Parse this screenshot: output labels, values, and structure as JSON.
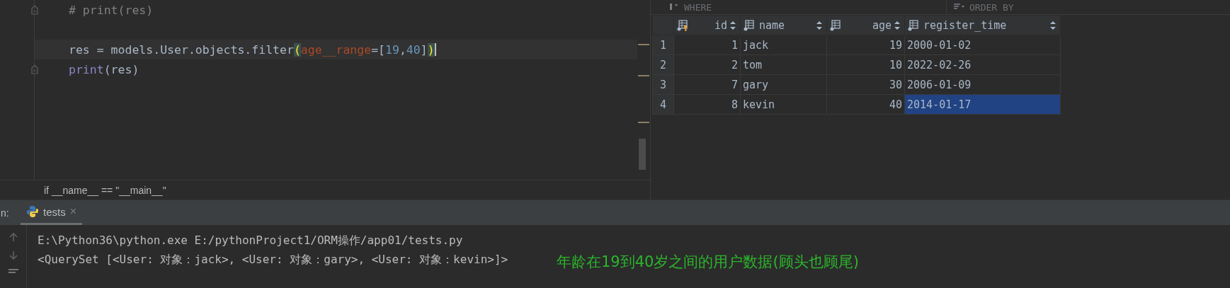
{
  "editor": {
    "lines": [
      {
        "tokens": [
          {
            "kind": "comment",
            "text": "# print(res)"
          }
        ],
        "current": false,
        "fold": true
      },
      {
        "current": false,
        "fold": false
      },
      {
        "tokens": [
          {
            "kind": "plain",
            "text": "res = models.User.objects.filter"
          },
          {
            "kind": "paren",
            "text": "("
          },
          {
            "kind": "kwarg",
            "text": "age__range"
          },
          {
            "kind": "plain",
            "text": "=["
          },
          {
            "kind": "number",
            "text": "19"
          },
          {
            "kind": "plain",
            "text": ","
          },
          {
            "kind": "number",
            "text": "40"
          },
          {
            "kind": "plain",
            "text": "]"
          },
          {
            "kind": "paren",
            "text": ")"
          }
        ],
        "current": true,
        "fold": false
      },
      {
        "tokens": [
          {
            "kind": "builtin",
            "text": "print"
          },
          {
            "kind": "plain",
            "text": "(res)"
          }
        ],
        "current": false,
        "fold": true
      }
    ],
    "breadcrumb": "if __name__ == \"__main__\""
  },
  "result_table": {
    "filters": [
      "WHERE",
      "ORDER BY"
    ],
    "columns": [
      {
        "label": "id",
        "kind": "key"
      },
      {
        "label": "name",
        "kind": "column"
      },
      {
        "label": "age",
        "kind": "column"
      },
      {
        "label": "register_time",
        "kind": "column"
      }
    ],
    "rows": [
      {
        "number": "1",
        "cells": [
          {
            "text": "1",
            "selected": false
          },
          {
            "text": "jack",
            "selected": false
          },
          {
            "text": "19",
            "selected": false
          },
          {
            "text": "2000-01-02",
            "selected": false
          }
        ]
      },
      {
        "number": "2",
        "cells": [
          {
            "text": "2",
            "selected": false
          },
          {
            "text": "tom",
            "selected": false
          },
          {
            "text": "10",
            "selected": false
          },
          {
            "text": "2022-02-26",
            "selected": false
          }
        ]
      },
      {
        "number": "3",
        "cells": [
          {
            "text": "7",
            "selected": false
          },
          {
            "text": "gary",
            "selected": false
          },
          {
            "text": "30",
            "selected": false
          },
          {
            "text": "2006-01-09",
            "selected": false
          }
        ]
      },
      {
        "number": "4",
        "cells": [
          {
            "text": "8",
            "selected": false
          },
          {
            "text": "kevin",
            "selected": false
          },
          {
            "text": "40",
            "selected": false
          },
          {
            "text": "2014-01-17",
            "selected": true
          }
        ]
      }
    ]
  },
  "run_panel": {
    "label": "n:",
    "tabs": [
      {
        "label": "tests",
        "selected": true,
        "close": "×"
      }
    ],
    "output": [
      "E:\\Python36\\python.exe E:/pythonProject1/ORM操作/app01/tests.py",
      "<QuerySet [<User: 对象：jack>, <User: 对象：gary>, <User: 对象：kevin>]>"
    ],
    "annotation": "年龄在19到40岁之间的用户数据(顾头也顾尾)"
  }
}
